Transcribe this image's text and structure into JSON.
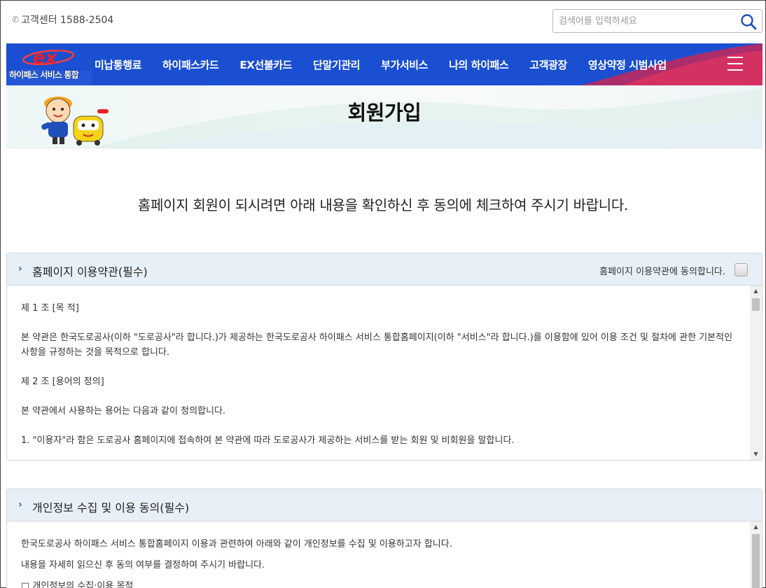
{
  "header": {
    "customer_center": "고객센터 1588-2504",
    "search_placeholder": "검색어를 입력하세요"
  },
  "logo": {
    "text": "하이패스 서비스 통합"
  },
  "nav": {
    "items": [
      {
        "label": "미납통행료"
      },
      {
        "label": "하이패스카드"
      },
      {
        "label": "EX선불카드"
      },
      {
        "label": "단말기관리"
      },
      {
        "label": "부가서비스"
      },
      {
        "label": "나의 하이패스"
      },
      {
        "label": "고객광장"
      },
      {
        "label": "영상약정 시범사업"
      }
    ]
  },
  "banner": {
    "title": "회원가입"
  },
  "notice": "홈페이지 회원이 되시려면 아래 내용을 확인하신 후 동의에 체크하여 주시기 바랍니다.",
  "terms_panel": {
    "title": "홈페이지 이용약관(필수)",
    "agree_label": "홈페이지 이용약관에 동의합니다.",
    "agree_checked": false,
    "paragraphs": [
      "제 1 조 [목 적]",
      "본 약관은 한국도로공사(이하 \"도로공사\"라 합니다.)가 제공하는 한국도로공사 하이패스 서비스 통합홈페이지(이하 \"서비스\"라 합니다.)를 이용함에 있어 이용 조건 및 절차에 관한 기본적인 사항을 규정하는 것을 목적으로 합니다.",
      "제 2 조 [용어의 정의]",
      "본 약관에서 사용하는 용어는 다음과 같이 정의합니다.",
      "1. \"이용자\"라 함은 도로공사 홈페이지에 접속하여 본 약관에 따라 도로공사가 제공하는 서비스를 받는 회원 및 비회원을 말합니다."
    ]
  },
  "privacy_panel": {
    "title": "개인정보 수집 및 이용 동의(필수)",
    "paragraphs": [
      "한국도로공사 하이패스 서비스 통합홈페이지 이용과 관련하여 아래와 같이 개인정보를 수집 및 이용하고자 합니다.",
      "내용을 자세히 읽으신 후 동의 여부를 결정하여 주시기 바랍니다.",
      "□ 개인정보의 수집·이용 목적"
    ]
  },
  "colors": {
    "nav_bg": "#1a4fd1",
    "panel_header_bg": "#e8f0f7",
    "accent": "#2a5bd7"
  }
}
